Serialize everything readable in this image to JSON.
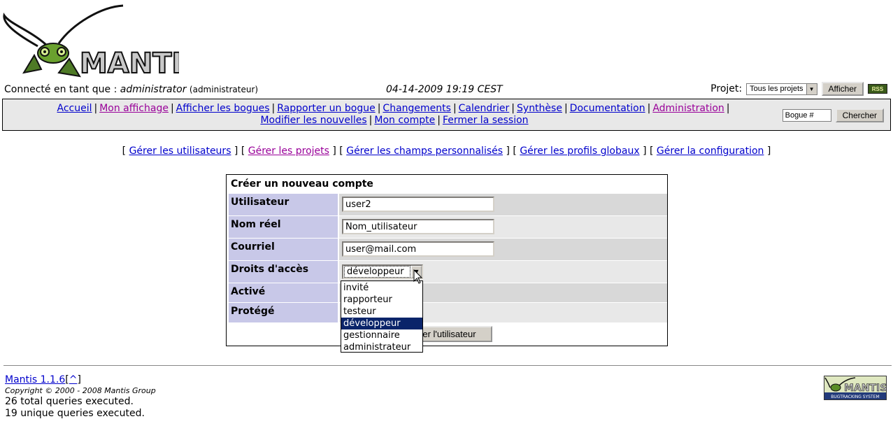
{
  "logo": {
    "text": "MANTIS"
  },
  "login": {
    "prefix": "Connecté en tant que :",
    "username": "administrator",
    "role": "(administrateur)",
    "datetime": "04-14-2009 19:19 CEST"
  },
  "project": {
    "label": "Projet:",
    "selected": "Tous les projets",
    "button": "Afficher",
    "rss": "RSS"
  },
  "menu": {
    "items": [
      {
        "label": "Accueil",
        "visited": false
      },
      {
        "label": "Mon affichage",
        "visited": true
      },
      {
        "label": "Afficher les bogues",
        "visited": false
      },
      {
        "label": "Rapporter un bogue",
        "visited": false
      },
      {
        "label": "Changements",
        "visited": false
      },
      {
        "label": "Calendrier",
        "visited": false
      },
      {
        "label": "Synthèse",
        "visited": false
      },
      {
        "label": "Documentation",
        "visited": false
      },
      {
        "label": "Administration",
        "visited": true
      },
      {
        "label": "Modifier les nouvelles",
        "visited": false
      },
      {
        "label": "Mon compte",
        "visited": false
      },
      {
        "label": "Fermer la session",
        "visited": false
      }
    ],
    "bug_input": "Bogue #",
    "search_button": "Chercher"
  },
  "submenu": {
    "items": [
      "Gérer les utilisateurs",
      "Gérer les projets",
      "Gérer les champs personnalisés",
      "Gérer les profils globaux",
      "Gérer la configuration"
    ]
  },
  "form": {
    "title": "Créer un nouveau compte",
    "username_label": "Utilisateur",
    "username_value": "user2",
    "realname_label": "Nom réel",
    "realname_value": "Nom_utilisateur",
    "email_label": "Courriel",
    "email_value": "user@mail.com",
    "access_label": "Droits d'accès",
    "access_value": "développeur",
    "enabled_label": "Activé",
    "protected_label": "Protégé",
    "submit_label": "Créer l'utilisateur",
    "access_options": [
      "invité",
      "rapporteur",
      "testeur",
      "développeur",
      "gestionnaire",
      "administrateur"
    ],
    "access_selected_index": 3
  },
  "footer": {
    "version": "Mantis 1.1.6",
    "top_link": "^",
    "copyright": "Copyright © 2000 - 2008 Mantis Group",
    "queries_total": "26 total queries executed.",
    "queries_unique": "19 unique queries executed.",
    "badge_text": "MANTIS",
    "badge_sub": "BUGTRACKING SYSTEM"
  },
  "colors": {
    "link": "#0000cc",
    "visited": "#990099",
    "category_bg": "#c8c8e8",
    "row_dark": "#d8d8d8",
    "row_light": "#e8e8e8",
    "selection": "#0a246a"
  }
}
